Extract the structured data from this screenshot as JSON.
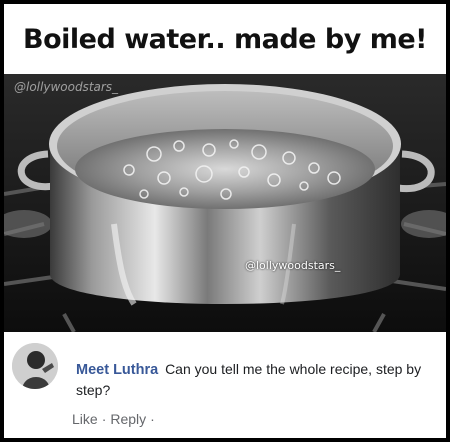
{
  "meme": {
    "caption": "Boiled water.. made by me!",
    "watermark_top": "@lollywoodstars_",
    "watermark_bottom": "@lollywoodstars_"
  },
  "comment": {
    "author": "Meet Luthra",
    "text": "Can you tell me the whole recipe, step by step?",
    "like_label": "Like",
    "reply_label": "Reply",
    "separator": "·",
    "trailing_separator": "·"
  },
  "colors": {
    "author_name": "#385898",
    "action_text": "#65676b",
    "comment_text": "#1c1e21"
  }
}
